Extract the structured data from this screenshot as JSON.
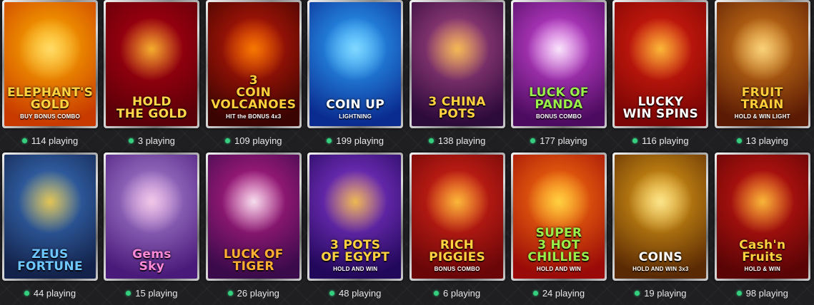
{
  "games": [
    {
      "title": "ELEPHANT'S\nGOLD",
      "subtitle": "BUY BONUS COMBO",
      "playing": "114 playing",
      "bg": [
        "#ffb400",
        "#c83a00"
      ],
      "accent": "#ffe27a",
      "text_color": "#ffd23f"
    },
    {
      "title": "HOLD\nTHE GOLD",
      "subtitle": "",
      "playing": "3 playing",
      "bg": [
        "#b40012",
        "#5a0008"
      ],
      "accent": "#ffcc33",
      "text_color": "#ffd84a"
    },
    {
      "title": "3\nCOIN\nVOLCANOES",
      "subtitle": "HIT the BONUS 4x3",
      "playing": "109 playing",
      "bg": [
        "#c81a08",
        "#3a0402"
      ],
      "accent": "#ff8a00",
      "text_color": "#ffd03a"
    },
    {
      "title": "COIN UP",
      "subtitle": "LIGHTNING",
      "playing": "199 playing",
      "bg": [
        "#2fa9ff",
        "#0a2b8f"
      ],
      "accent": "#8fe0ff",
      "text_color": "#ffffff"
    },
    {
      "title": "3 CHINA\nPOTS",
      "subtitle": "",
      "playing": "138 playing",
      "bg": [
        "#b04a8a",
        "#2c0a3a"
      ],
      "accent": "#ffce4a",
      "text_color": "#ffd23f"
    },
    {
      "title": "LUCK OF\nPANDA",
      "subtitle": "BONUS COMBO",
      "playing": "177 playing",
      "bg": [
        "#d448e0",
        "#4c0b5e"
      ],
      "accent": "#ffffff",
      "text_color": "#9af04a"
    },
    {
      "title": "LUCKY\nWIN SPINS",
      "subtitle": "",
      "playing": "116 playing",
      "bg": [
        "#e02010",
        "#7a0504"
      ],
      "accent": "#ffd23f",
      "text_color": "#ffffff"
    },
    {
      "title": "FRUIT TRAIN",
      "subtitle": "HOLD & WIN LIGHT",
      "playing": "13 playing",
      "bg": [
        "#d8801a",
        "#5a1a04"
      ],
      "accent": "#ffe08a",
      "text_color": "#ffce3a"
    },
    {
      "title": "ZEUS\nFORTUNE",
      "subtitle": "",
      "playing": "44 playing",
      "bg": [
        "#3c78c8",
        "#13224a"
      ],
      "accent": "#ffd23f",
      "text_color": "#6ec8ff"
    },
    {
      "title": "Gems\nSky",
      "subtitle": "",
      "playing": "15 playing",
      "bg": [
        "#b08ad8",
        "#4a1a7a"
      ],
      "accent": "#ffd0ea",
      "text_color": "#ff88d8"
    },
    {
      "title": "LUCK OF\nTIGER",
      "subtitle": "",
      "playing": "26 playing",
      "bg": [
        "#c0208a",
        "#3a0a4a"
      ],
      "accent": "#ffffff",
      "text_color": "#ffb030"
    },
    {
      "title": "3 POTS\nOF EGYPT",
      "subtitle": "HOLD AND WIN",
      "playing": "48 playing",
      "bg": [
        "#8a3ad8",
        "#22085a"
      ],
      "accent": "#ffce3a",
      "text_color": "#ffd23f"
    },
    {
      "title": "RICH\nPIGGIES",
      "subtitle": "BONUS COMBO",
      "playing": "6 playing",
      "bg": [
        "#e02618",
        "#6a0608"
      ],
      "accent": "#ffd23f",
      "text_color": "#ffd23f"
    },
    {
      "title": "SUPER\n3 HOT\nCHILLIES",
      "subtitle": "HOLD AND WIN",
      "playing": "24 playing",
      "bg": [
        "#ff7a10",
        "#9a0a08"
      ],
      "accent": "#ffe04a",
      "text_color": "#9af04a"
    },
    {
      "title": "COINS",
      "subtitle": "HOLD AND WIN 3x3",
      "playing": "19 playing",
      "bg": [
        "#e8a418",
        "#5a2a04"
      ],
      "accent": "#fff0a0",
      "text_color": "#ffffff"
    },
    {
      "title": "Cash'n\nFruits",
      "subtitle": "HOLD & WIN",
      "playing": "98 playing",
      "bg": [
        "#d01812",
        "#5a0406"
      ],
      "accent": "#ffd23f",
      "text_color": "#ffd23f"
    }
  ]
}
